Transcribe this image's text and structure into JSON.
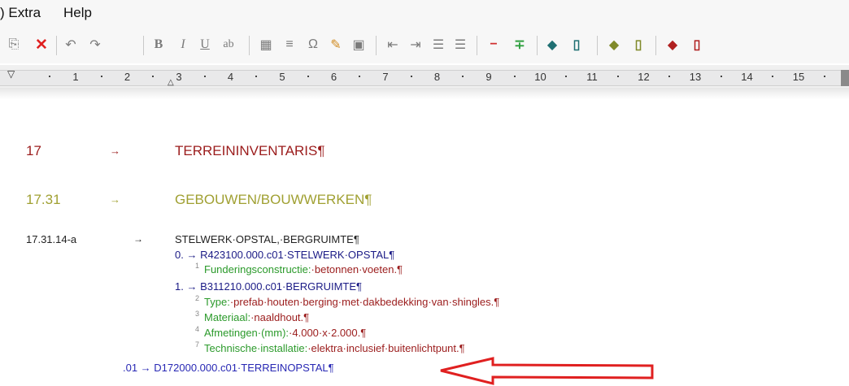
{
  "menu": [
    {
      "label": ") Extra"
    },
    {
      "label": "Help"
    }
  ],
  "toolbar": {
    "buttons": [
      {
        "glyph": "⎘",
        "icon": "paste-icon"
      },
      {
        "glyph": "✕",
        "icon": "delete-icon"
      },
      {
        "glyph": "↶",
        "icon": "undo-icon"
      },
      {
        "glyph": "↷",
        "icon": "redo-icon"
      },
      {
        "glyph": "B",
        "icon": "bold-icon"
      },
      {
        "glyph": "I",
        "icon": "italic-icon"
      },
      {
        "glyph": "U",
        "icon": "underline-icon"
      },
      {
        "glyph": "ab",
        "icon": "strikethrough-icon"
      },
      {
        "glyph": "▦",
        "icon": "insert-icon"
      },
      {
        "glyph": "≡",
        "icon": "style-icon"
      },
      {
        "glyph": "Ω",
        "icon": "symbol-icon"
      },
      {
        "glyph": "✎",
        "icon": "edit-icon"
      },
      {
        "glyph": "▣",
        "icon": "properties-icon"
      },
      {
        "glyph": "⇤",
        "icon": "decrease-indent-icon"
      },
      {
        "glyph": "⇥",
        "icon": "increase-indent-icon"
      },
      {
        "glyph": "☰",
        "icon": "numbered-list-icon"
      },
      {
        "glyph": "☰",
        "icon": "bullet-list-icon"
      },
      {
        "glyph": "−",
        "icon": "remove-line-icon"
      },
      {
        "glyph": "∓",
        "icon": "add-line-icon"
      },
      {
        "glyph": "◆",
        "icon": "teal-book-icon"
      },
      {
        "glyph": "▯",
        "icon": "teal-open-book-icon"
      },
      {
        "glyph": "◆",
        "icon": "olive-book-icon"
      },
      {
        "glyph": "▯",
        "icon": "olive-open-book-icon"
      },
      {
        "glyph": "◆",
        "icon": "red-book-icon"
      },
      {
        "glyph": "▯",
        "icon": "red-open-book-icon"
      }
    ]
  },
  "ruler": {
    "numbers": [
      "1",
      "2",
      "3",
      "4",
      "5",
      "6",
      "7",
      "8",
      "9",
      "10",
      "11",
      "12",
      "13",
      "14",
      "15"
    ]
  },
  "document": {
    "h1": {
      "number": "17",
      "arrow": "→",
      "title": "TERREININVENTARIS¶"
    },
    "h2": {
      "number": "17.31",
      "arrow": "→",
      "title": "GEBOUWEN/BOUWWERKEN¶"
    },
    "item": {
      "number": "17.31.14-a",
      "arrow": "→",
      "title": "STELWERK·OPSTAL,·BERGRUIMTE¶"
    },
    "sub0": {
      "text": "0.  →  R423100.000.c01·STELWERK·OPSTAL¶"
    },
    "spec1": {
      "num": "1",
      "label": "Funderingsconstructie:",
      "value": "·betonnen·voeten.¶"
    },
    "sub1": {
      "text": "1.  →  B311210.000.c01·BERGRUIMTE¶"
    },
    "spec2": {
      "num": "2",
      "label": "Type:",
      "value": "·prefab·houten·berging·met·dakbedekking·van·shingles.¶"
    },
    "spec3": {
      "num": "3",
      "label": "Materiaal:",
      "value": "·naaldhout.¶"
    },
    "spec4": {
      "num": "4",
      "label": "Afmetingen·(mm):",
      "value": "·4.000·x·2.000.¶"
    },
    "spec7": {
      "num": "7",
      "label": "Technische·installatie:",
      "value": "·elektra·inclusief·buitenlichtpunt.¶"
    },
    "sub01": {
      "text": ".01 → D172000.000.c01·TERREINOPSTAL¶"
    }
  },
  "colors": {
    "annotation_arrow": "#e02020"
  }
}
